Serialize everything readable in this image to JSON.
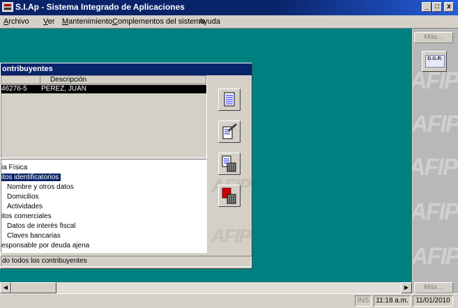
{
  "window": {
    "title": "S.I.Ap - Sistema Integrado de Aplicaciones",
    "controls": [
      "_",
      "□",
      "x"
    ]
  },
  "menu": [
    {
      "label": "Archivo",
      "mnemonic": "A",
      "rest": "rchivo"
    },
    {
      "label": "Ver",
      "mnemonic": "V",
      "rest": "er"
    },
    {
      "label": "Mantenimiento",
      "mnemonic": "M",
      "rest": "antenimiento"
    },
    {
      "label": "Complementos del sistema",
      "mnemonic": "C",
      "rest": "omplementos del sistema"
    },
    {
      "label": "Ayuda",
      "mnemonic": "",
      "rest": "Ayuda"
    }
  ],
  "right_panel": {
    "more_top": "Más...",
    "dgr_label": "D.G.R.",
    "more_bottom": "Más..."
  },
  "child": {
    "title": "ontribuyentes",
    "grid": {
      "columns": [
        "",
        "Descripción"
      ],
      "row": {
        "id": "46276-5",
        "description": "PEREZ, JUAN"
      }
    },
    "tree": [
      {
        "label": "ia Física",
        "indent": 0,
        "selected": false
      },
      {
        "label": "itos identificatorios",
        "indent": 0,
        "selected": true
      },
      {
        "label": "Nombre y otros datos",
        "indent": 1,
        "selected": false
      },
      {
        "label": "Domicilios",
        "indent": 1,
        "selected": false
      },
      {
        "label": "Actividades",
        "indent": 1,
        "selected": false
      },
      {
        "label": "itos comerciales",
        "indent": 0,
        "selected": false
      },
      {
        "label": "Datos de interés fiscal",
        "indent": 1,
        "selected": false
      },
      {
        "label": "Claves bancarias",
        "indent": 1,
        "selected": false
      },
      {
        "label": "esponsable por deuda ajena",
        "indent": 0,
        "selected": false
      }
    ],
    "status": "do todos los contribuyentes",
    "tools": [
      "document-icon",
      "edit-document-icon",
      "delete-document-icon",
      "trash-icon"
    ]
  },
  "statusbar": {
    "ins": "INS",
    "time": "11:18 a.m.",
    "date": "11/01/2010"
  },
  "watermark_text": "AFIP"
}
